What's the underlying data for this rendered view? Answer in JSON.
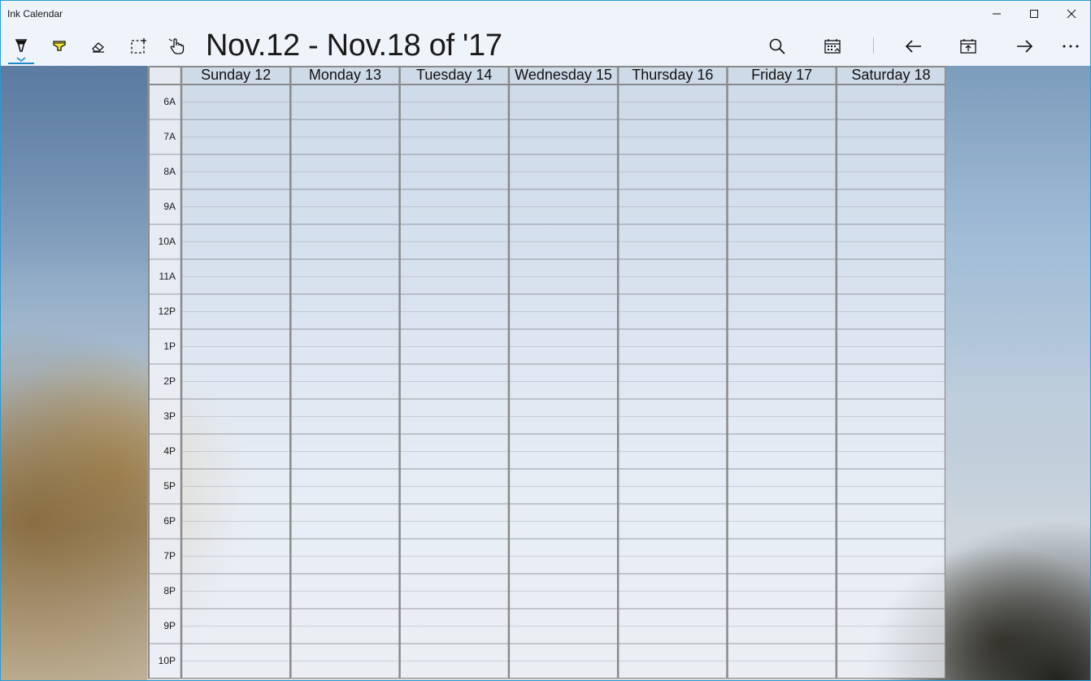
{
  "app": {
    "title": "Ink Calendar"
  },
  "window_controls": {
    "minimize_icon": "minimize-icon",
    "maximize_icon": "maximize-icon",
    "close_icon": "close-icon"
  },
  "toolbar": {
    "tools": [
      {
        "name": "pen-tool",
        "icon": "pen-icon",
        "active": true
      },
      {
        "name": "highlighter-tool",
        "icon": "highlighter-icon",
        "active": false
      },
      {
        "name": "eraser-tool",
        "icon": "eraser-icon",
        "active": false
      },
      {
        "name": "lasso-select-tool",
        "icon": "lasso-select-icon",
        "active": false
      },
      {
        "name": "touch-pan-tool",
        "icon": "hand-touch-icon",
        "active": false
      }
    ],
    "week_title": "Nov.12 - Nov.18 of '17",
    "actions": [
      {
        "name": "search-button",
        "icon": "search-icon"
      },
      {
        "name": "calendar-picker-button",
        "icon": "calendar-icon"
      },
      {
        "name": "previous-week-button",
        "icon": "arrow-left-icon"
      },
      {
        "name": "today-button",
        "icon": "calendar-today-icon"
      },
      {
        "name": "next-week-button",
        "icon": "arrow-right-icon"
      },
      {
        "name": "more-button",
        "icon": "more-icon"
      }
    ],
    "accent_color": "#1e88c9"
  },
  "calendar": {
    "days": [
      "Sunday 12",
      "Monday 13",
      "Tuesday 14",
      "Wednesday 15",
      "Thursday 16",
      "Friday 17",
      "Saturday 18"
    ],
    "hours": [
      "6A",
      "7A",
      "8A",
      "9A",
      "10A",
      "11A",
      "12P",
      "1P",
      "2P",
      "3P",
      "4P",
      "5P",
      "6P",
      "7P",
      "8P",
      "9P",
      "10P"
    ],
    "grid_color": "#8a8a8a"
  }
}
